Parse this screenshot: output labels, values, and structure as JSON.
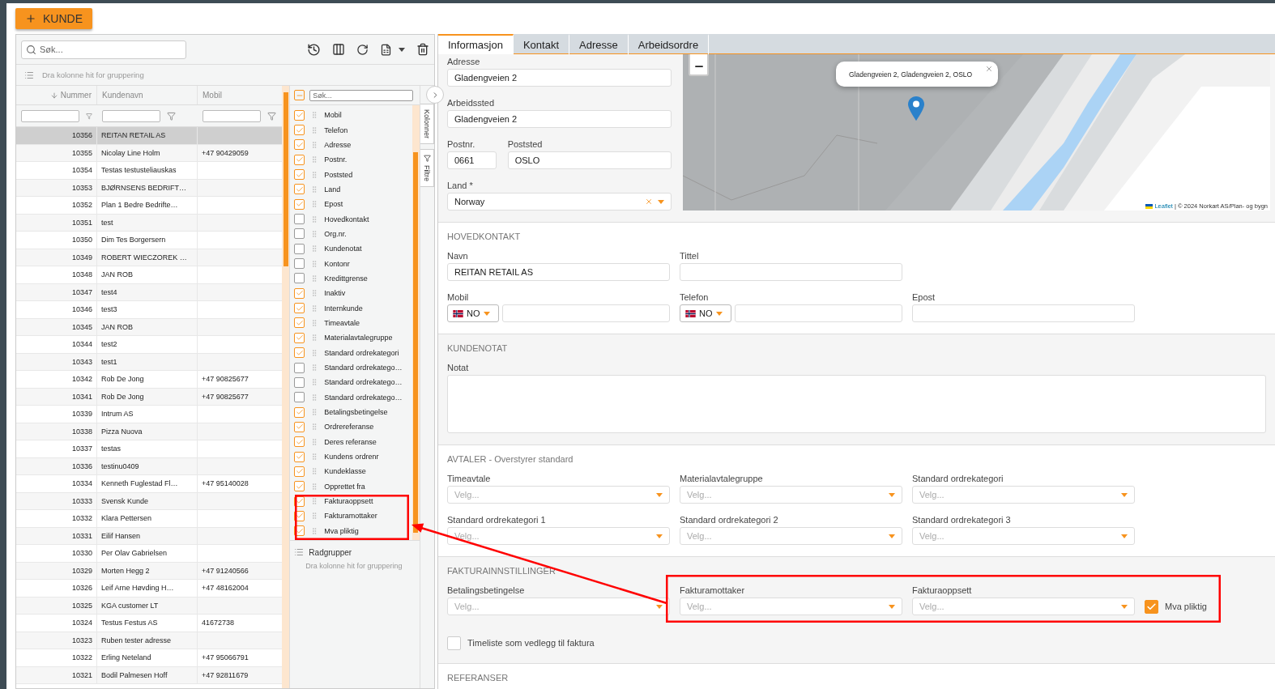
{
  "add_button": {
    "label": "KUNDE"
  },
  "toolbar": {
    "search_placeholder": "Søk..."
  },
  "group_hint": "Dra kolonne hit for gruppering",
  "table": {
    "columns": [
      {
        "label": "Nummer",
        "sorted": true
      },
      {
        "label": "Kundenavn",
        "sorted": false
      },
      {
        "label": "Mobil",
        "sorted": false
      }
    ],
    "rows": [
      {
        "number": "10356",
        "name": "REITAN RETAIL AS",
        "selected": true
      },
      {
        "number": "10355",
        "name": "Nicolay Line Holm",
        "mobile": "+47 90429059",
        "selected": false
      },
      {
        "number": "10354",
        "name": "Testas testusteliauskas",
        "selected": false
      },
      {
        "number": "10353",
        "name": "BJØRNSENS BEDRIFT…",
        "selected": false
      },
      {
        "number": "10352",
        "name": "Plan 1 Bedre Bedrifte…",
        "selected": false
      },
      {
        "number": "10351",
        "name": "test",
        "selected": false
      },
      {
        "number": "10350",
        "name": "Dim Tes Borgersern",
        "selected": false
      },
      {
        "number": "10349",
        "name": "ROBERT WIECZOREK …",
        "selected": false
      },
      {
        "number": "10348",
        "name": "JAN ROB",
        "selected": false
      },
      {
        "number": "10347",
        "name": "test4",
        "selected": false
      },
      {
        "number": "10346",
        "name": "test3",
        "selected": false
      },
      {
        "number": "10345",
        "name": "JAN ROB",
        "selected": false
      },
      {
        "number": "10344",
        "name": "test2",
        "selected": false
      },
      {
        "number": "10343",
        "name": "test1",
        "selected": false
      },
      {
        "number": "10342",
        "name": "Rob De Jong",
        "mobile": "+47 90825677",
        "selected": false
      },
      {
        "number": "10341",
        "name": "Rob De Jong",
        "mobile": "+47 90825677",
        "selected": false
      },
      {
        "number": "10339",
        "name": "Intrum AS",
        "selected": false
      },
      {
        "number": "10338",
        "name": "Pizza Nuova",
        "selected": false
      },
      {
        "number": "10337",
        "name": "testas",
        "selected": false
      },
      {
        "number": "10336",
        "name": "testinu0409",
        "selected": false
      },
      {
        "number": "10334",
        "name": "Kenneth Fuglestad Fl…",
        "mobile": "+47 95140028",
        "selected": false
      },
      {
        "number": "10333",
        "name": "Svensk Kunde",
        "selected": false
      },
      {
        "number": "10332",
        "name": "Klara Pettersen",
        "selected": false
      },
      {
        "number": "10331",
        "name": "Eilif Hansen",
        "selected": false
      },
      {
        "number": "10330",
        "name": "Per Olav Gabrielsen",
        "selected": false
      },
      {
        "number": "10329",
        "name": "Morten Hegg 2",
        "mobile": "+47 91240566",
        "selected": false
      },
      {
        "number": "10326",
        "name": "Leif Arne Høvding H…",
        "mobile": "+47 48162004",
        "selected": false
      },
      {
        "number": "10325",
        "name": "KGA customer LT",
        "selected": false
      },
      {
        "number": "10324",
        "name": "Testus Festus AS",
        "mobile": "41672738",
        "selected": false
      },
      {
        "number": "10323",
        "name": "Ruben tester adresse",
        "selected": false
      },
      {
        "number": "10322",
        "name": "Erling Neteland",
        "mobile": "+47 95066791",
        "selected": false
      },
      {
        "number": "10321",
        "name": "Bodil Palmesen Hoff",
        "mobile": "+47 92811679",
        "selected": false
      }
    ]
  },
  "column_chooser": {
    "search_placeholder": "Søk...",
    "select_all_partial": true,
    "items": [
      {
        "label": "Mobil",
        "checked": true
      },
      {
        "label": "Telefon",
        "checked": true
      },
      {
        "label": "Adresse",
        "checked": true
      },
      {
        "label": "Postnr.",
        "checked": true
      },
      {
        "label": "Poststed",
        "checked": true
      },
      {
        "label": "Land",
        "checked": true
      },
      {
        "label": "Epost",
        "checked": true
      },
      {
        "label": "Hovedkontakt",
        "checked": false
      },
      {
        "label": "Org.nr.",
        "checked": false
      },
      {
        "label": "Kundenotat",
        "checked": false
      },
      {
        "label": "Kontonr",
        "checked": false
      },
      {
        "label": "Kredittgrense",
        "checked": false
      },
      {
        "label": "Inaktiv",
        "checked": true
      },
      {
        "label": "Internkunde",
        "checked": true
      },
      {
        "label": "Timeavtale",
        "checked": true
      },
      {
        "label": "Materialavtalegruppe",
        "checked": true
      },
      {
        "label": "Standard ordrekategori",
        "checked": true
      },
      {
        "label": "Standard ordrekatego…",
        "checked": false
      },
      {
        "label": "Standard ordrekatego…",
        "checked": false
      },
      {
        "label": "Standard ordrekatego…",
        "checked": false
      },
      {
        "label": "Betalingsbetingelse",
        "checked": true
      },
      {
        "label": "Ordrereferanse",
        "checked": true
      },
      {
        "label": "Deres referanse",
        "checked": true
      },
      {
        "label": "Kundens ordrenr",
        "checked": true
      },
      {
        "label": "Kundeklasse",
        "checked": true
      },
      {
        "label": "Opprettet fra",
        "checked": true
      },
      {
        "label": "Fakturaoppsett",
        "checked": true
      },
      {
        "label": "Fakturamottaker",
        "checked": true
      },
      {
        "label": "Mva pliktig",
        "checked": true
      }
    ],
    "row_groups": {
      "title": "Radgrupper",
      "hint": "Dra kolonne hit for gruppering"
    }
  },
  "side_tabs": [
    {
      "label": "Kolonner"
    },
    {
      "label": "Filtre"
    }
  ],
  "detail": {
    "tabs": [
      {
        "label": "Informasjon",
        "selected": true
      },
      {
        "label": "Kontakt",
        "selected": false
      },
      {
        "label": "Adresse",
        "selected": false
      },
      {
        "label": "Arbeidsordre",
        "selected": false
      }
    ],
    "address": {
      "adresse": {
        "label": "Adresse",
        "value": "Gladengveien 2"
      },
      "arbeidssted": {
        "label": "Arbeidssted",
        "value": "Gladengveien 2"
      },
      "postnr": {
        "label": "Postnr.",
        "value": "0661"
      },
      "poststed": {
        "label": "Poststed",
        "value": "OSLO"
      },
      "land": {
        "label": "Land *",
        "value": "Norway"
      }
    },
    "map": {
      "popup": "Gladengveien 2, Gladengveien 2, OSLO",
      "attribution_link": "Leaflet",
      "attribution": "| © 2024 Norkart AS/Plan- og bygn"
    },
    "sections": [
      {
        "title": "HOVEDKONTAKT",
        "rows": [
          [
            {
              "kind": "text",
              "label": "Navn",
              "value": "REITAN RETAIL AS"
            },
            {
              "kind": "text",
              "label": "Tittel"
            }
          ],
          [
            {
              "kind": "phone",
              "label": "Mobil",
              "country": "NO"
            },
            {
              "kind": "phone",
              "label": "Telefon",
              "country": "NO"
            },
            {
              "kind": "text",
              "label": "Epost"
            }
          ]
        ]
      },
      {
        "title": "KUNDENOTAT",
        "rows": [
          [
            {
              "kind": "textarea",
              "label": "Notat"
            }
          ]
        ]
      },
      {
        "title": "AVTALER - Overstyrer standard",
        "rows": [
          [
            {
              "kind": "select",
              "label": "Timeavtale",
              "placeholder": "Velg..."
            },
            {
              "kind": "select",
              "label": "Materialavtalegruppe",
              "placeholder": "Velg..."
            },
            {
              "kind": "select",
              "label": "Standard ordrekategori",
              "placeholder": "Velg..."
            }
          ],
          [
            {
              "kind": "select",
              "label": "Standard ordrekategori 1",
              "placeholder": "Velg..."
            },
            {
              "kind": "select",
              "label": "Standard ordrekategori 2",
              "placeholder": "Velg..."
            },
            {
              "kind": "select",
              "label": "Standard ordrekategori 3",
              "placeholder": "Velg..."
            }
          ]
        ]
      },
      {
        "title": "FAKTURAINNSTILLINGER",
        "rows": [
          [
            {
              "kind": "select",
              "label": "Betalingsbetingelse",
              "placeholder": "Velg..."
            },
            {
              "kind": "select",
              "label": "Fakturamottaker",
              "placeholder": "Velg..."
            },
            {
              "kind": "select",
              "label": "Fakturaoppsett",
              "placeholder": "Velg..."
            },
            {
              "kind": "check",
              "label": "Mva pliktig",
              "checked": true
            }
          ],
          [
            {
              "kind": "check",
              "label": "Timeliste som vedlegg til faktura",
              "checked": false
            }
          ]
        ]
      },
      {
        "title": "REFERANSER"
      }
    ]
  },
  "annotations": [
    {
      "kind": "frame"
    },
    {
      "kind": "frame"
    },
    {
      "kind": "arrow"
    }
  ]
}
